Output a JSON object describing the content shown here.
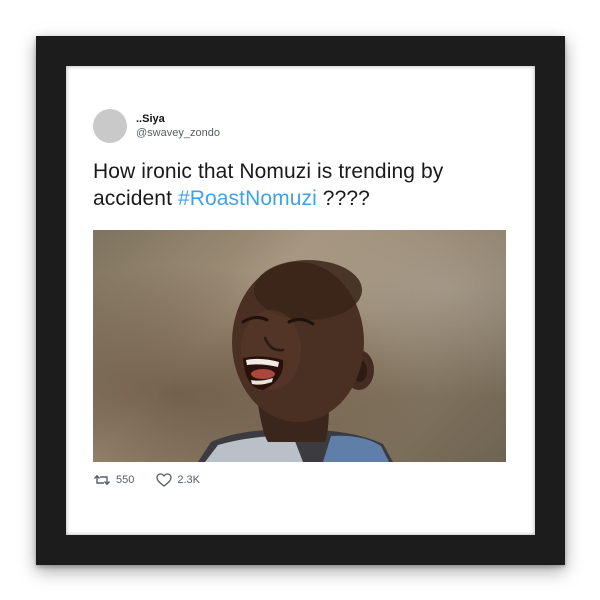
{
  "tweet": {
    "display_name": "..Siya",
    "handle": "@swavey_zondo",
    "text_before": "How ironic that Nomuzi is trending by accident ",
    "hashtag": "#RoastNomuzi",
    "text_after": " ????",
    "retweet_count": "550",
    "like_count": "2.3K",
    "hashtag_color": "#3fa2e8"
  },
  "icons": {
    "retweet": "retweet-icon",
    "like": "heart-icon"
  },
  "photo": {
    "subject": "laughing child outdoors"
  }
}
